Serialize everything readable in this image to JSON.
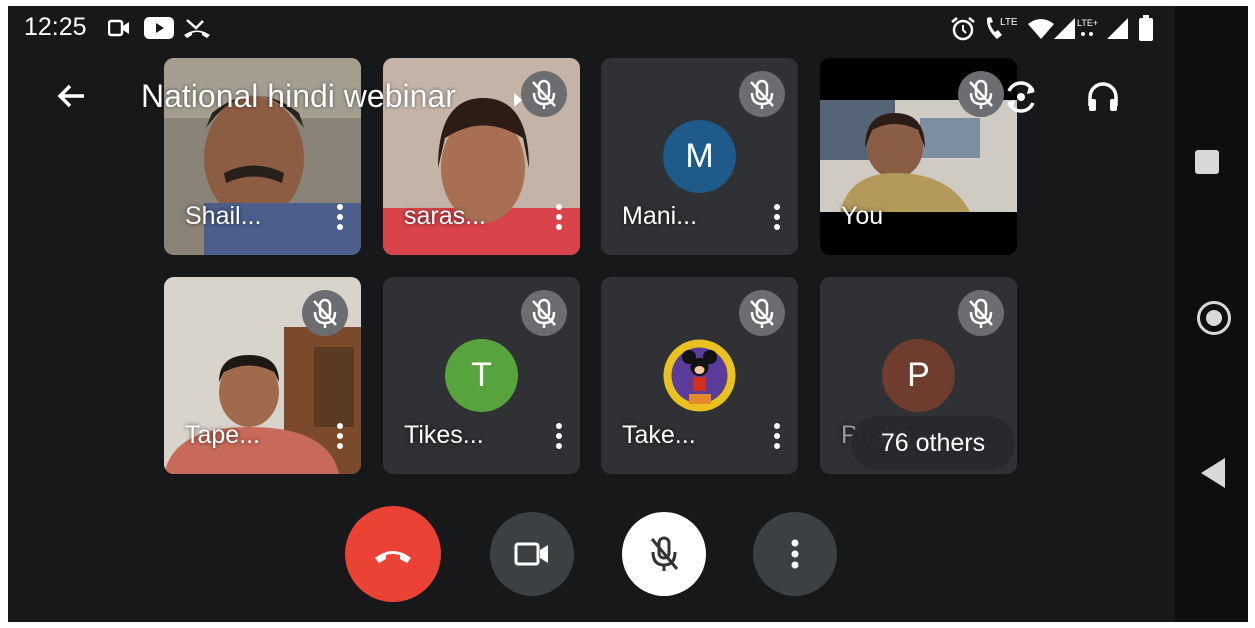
{
  "status_bar": {
    "time": "12:25",
    "lte_label": "LTE",
    "lte_plus_label": "LTE+",
    "icons": [
      "video-icon",
      "youtube-icon",
      "missed-call-icon",
      "alarm-icon",
      "wifi-icon",
      "signal-icon",
      "battery-icon"
    ]
  },
  "header": {
    "title": "National hindi webinar",
    "icons": [
      "back-arrow-icon",
      "caret-right-icon",
      "flip-camera-icon",
      "headphones-icon"
    ]
  },
  "participants": [
    {
      "name": "Shail...",
      "type": "video",
      "muted": false
    },
    {
      "name": "saras...",
      "type": "video",
      "muted": true
    },
    {
      "name": "Mani...",
      "type": "avatar",
      "initial": "M",
      "avatar_color": "#1e5a8a",
      "muted": true
    },
    {
      "name": "You",
      "type": "video",
      "muted": true
    },
    {
      "name": "Tape...",
      "type": "video",
      "muted": true
    },
    {
      "name": "Tikes...",
      "type": "avatar",
      "initial": "T",
      "avatar_color": "#57a33c",
      "muted": true
    },
    {
      "name": "Take...",
      "type": "image-avatar",
      "muted": true
    },
    {
      "name": "Pushp",
      "type": "avatar",
      "initial": "P",
      "avatar_color": "#6f3d2e",
      "muted": true
    }
  ],
  "others_chip": {
    "label": "76 others"
  },
  "controls": {
    "end_call_color": "#ea4335",
    "items": [
      "end-call",
      "camera",
      "microphone",
      "more-options"
    ]
  },
  "nav_bar": {
    "items": [
      "recents",
      "home",
      "back"
    ]
  }
}
